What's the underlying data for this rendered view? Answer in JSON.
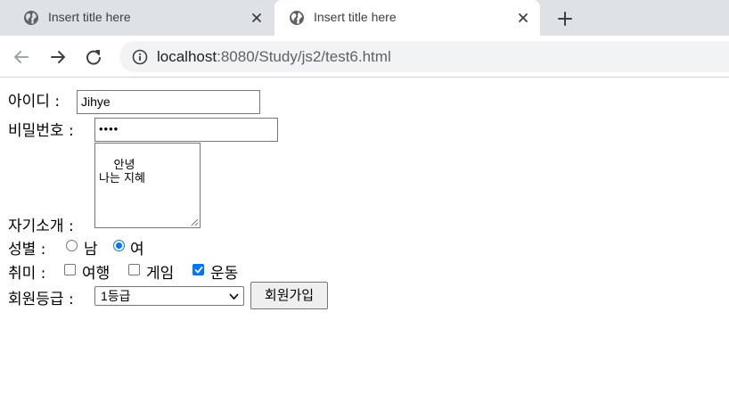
{
  "browser": {
    "tabs": [
      {
        "title": "Insert title here"
      },
      {
        "title": "Insert title here"
      }
    ],
    "address": {
      "host": "localhost",
      "path": ":8080/Study/js2/test6.html"
    }
  },
  "form": {
    "id": {
      "label": "아이디 :",
      "value": "Jihye"
    },
    "password": {
      "label": "비밀번호 :",
      "value": "••••"
    },
    "intro": {
      "label": "자기소개 :",
      "value": "안녕\n나는 지혜"
    },
    "gender": {
      "label": "성별 :",
      "options": [
        {
          "label": "남",
          "checked": false
        },
        {
          "label": "여",
          "checked": true
        }
      ]
    },
    "hobby": {
      "label": "취미 :",
      "options": [
        {
          "label": "여행",
          "checked": false
        },
        {
          "label": "게임",
          "checked": false
        },
        {
          "label": "운동",
          "checked": true
        }
      ]
    },
    "grade": {
      "label": "회원등급 :",
      "selected": "1등급"
    },
    "submit_label": "회원가입"
  },
  "colors": {
    "accent": "#0075ff",
    "tabbar": "#dee1e6",
    "omnibox": "#f1f3f4"
  },
  "icons": [
    "globe-icon",
    "close-icon",
    "plus-icon",
    "back-arrow-icon",
    "forward-arrow-icon",
    "reload-icon",
    "info-icon",
    "chevron-down-icon",
    "checkmark-icon",
    "resize-grip-icon"
  ]
}
